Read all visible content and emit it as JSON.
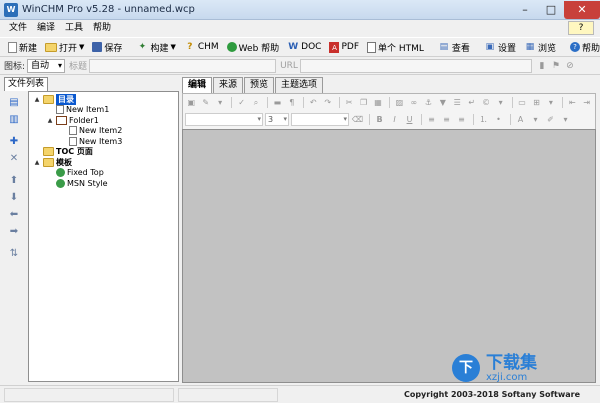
{
  "window": {
    "title": "WinCHM Pro v5.28 - unnamed.wcp",
    "app_icon": "W",
    "minimize": "–",
    "maximize": "□",
    "close": "✕"
  },
  "menu": {
    "items": [
      "文件",
      "编译",
      "工具",
      "帮助"
    ],
    "help_badge": "?"
  },
  "toolbar": {
    "new": "新建",
    "open": "打开",
    "save": "保存",
    "build": "构建",
    "chm": "CHM",
    "web_help": "Web 帮助",
    "doc": "DOC",
    "pdf": "PDF",
    "single_html": "单个 HTML",
    "view": "查看",
    "settings": "设置",
    "browse": "浏览",
    "help": "帮助"
  },
  "fieldbar": {
    "icon_label": "图标:",
    "icon_value": "自动",
    "title_label": "标题",
    "url_label": "URL"
  },
  "left_panel": {
    "tab_label": "文件列表",
    "tree": [
      {
        "label": "目录",
        "icon": "folder",
        "indent": 0,
        "toggle": "▲",
        "style": "sel bold"
      },
      {
        "label": "New Item1",
        "icon": "page",
        "indent": 1,
        "toggle": "",
        "style": ""
      },
      {
        "label": "Folder1",
        "icon": "book",
        "indent": 1,
        "toggle": "▲",
        "style": ""
      },
      {
        "label": "New Item2",
        "icon": "page",
        "indent": 2,
        "toggle": "",
        "style": ""
      },
      {
        "label": "New Item3",
        "icon": "page",
        "indent": 2,
        "toggle": "",
        "style": ""
      },
      {
        "label": "TOC 页面",
        "icon": "folder",
        "indent": 0,
        "toggle": "",
        "style": "bold"
      },
      {
        "label": "模板",
        "icon": "folder",
        "indent": 0,
        "toggle": "▲",
        "style": "bold"
      },
      {
        "label": "Fixed Top",
        "icon": "globe",
        "indent": 1,
        "toggle": "",
        "style": ""
      },
      {
        "label": "MSN Style",
        "icon": "globe",
        "indent": 1,
        "toggle": "",
        "style": ""
      }
    ]
  },
  "editor": {
    "tabs": [
      "编辑",
      "来源",
      "预览",
      "主题选项"
    ],
    "font_size_value": "3"
  },
  "status": {
    "copyright": "Copyright 2003-2018 Softany Software"
  },
  "watermark": {
    "logo": "下",
    "title": "下载集",
    "url": "xzji.com"
  },
  "colors": {
    "selection": "#0a58cf",
    "editor_bg": "#c2c2c2",
    "accent": "#2a7fd6"
  }
}
